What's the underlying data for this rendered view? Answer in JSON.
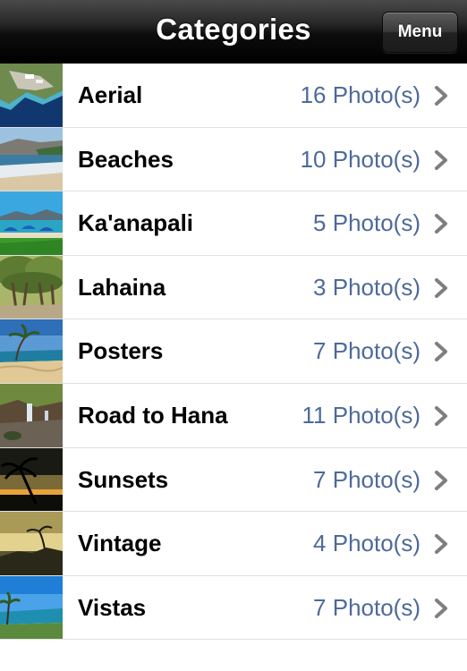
{
  "navbar": {
    "title": "Categories",
    "menu_label": "Menu"
  },
  "categories": [
    {
      "name": "Aerial",
      "count": "16 Photo(s)",
      "thumb": "aerial-coastline"
    },
    {
      "name": "Beaches",
      "count": "10 Photo(s)",
      "thumb": "beach-shoreline"
    },
    {
      "name": "Ka'anapali",
      "count": "5 Photo(s)",
      "thumb": "beach-umbrellas"
    },
    {
      "name": "Lahaina",
      "count": "3 Photo(s)",
      "thumb": "banyan-tree"
    },
    {
      "name": "Posters",
      "count": "7 Photo(s)",
      "thumb": "palm-beach"
    },
    {
      "name": "Road to Hana",
      "count": "11 Photo(s)",
      "thumb": "waterfall"
    },
    {
      "name": "Sunsets",
      "count": "7 Photo(s)",
      "thumb": "palm-sunset"
    },
    {
      "name": "Vintage",
      "count": "4 Photo(s)",
      "thumb": "vintage-sunset"
    },
    {
      "name": "Vistas",
      "count": "7 Photo(s)",
      "thumb": "coastal-vista"
    }
  ],
  "colors": {
    "count_text": "#4d6a99",
    "chevron": "#7f7f7f",
    "separator": "#e0e0e0"
  }
}
